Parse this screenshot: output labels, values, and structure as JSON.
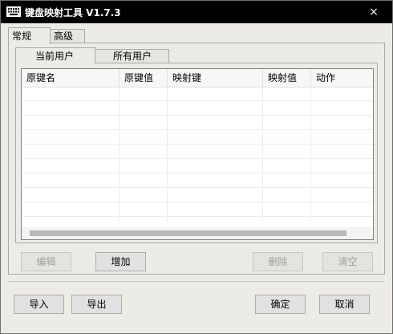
{
  "window": {
    "title": "键盘映射工具 V1.7.3",
    "close_glyph": "×"
  },
  "tabs": [
    {
      "label": "常规",
      "selected": true
    },
    {
      "label": "高级",
      "selected": false
    }
  ],
  "subtabs": [
    {
      "label": "当前用户",
      "selected": true
    },
    {
      "label": "所有用户",
      "selected": false
    }
  ],
  "table": {
    "columns": [
      "原键名",
      "原键值",
      "映射键",
      "映射值",
      "动作"
    ],
    "rows": []
  },
  "actions": {
    "edit": "编辑",
    "add": "增加",
    "delete": "删除",
    "clear": "清空"
  },
  "footer": {
    "import": "导入",
    "export": "导出",
    "ok": "确定",
    "cancel": "取消"
  }
}
